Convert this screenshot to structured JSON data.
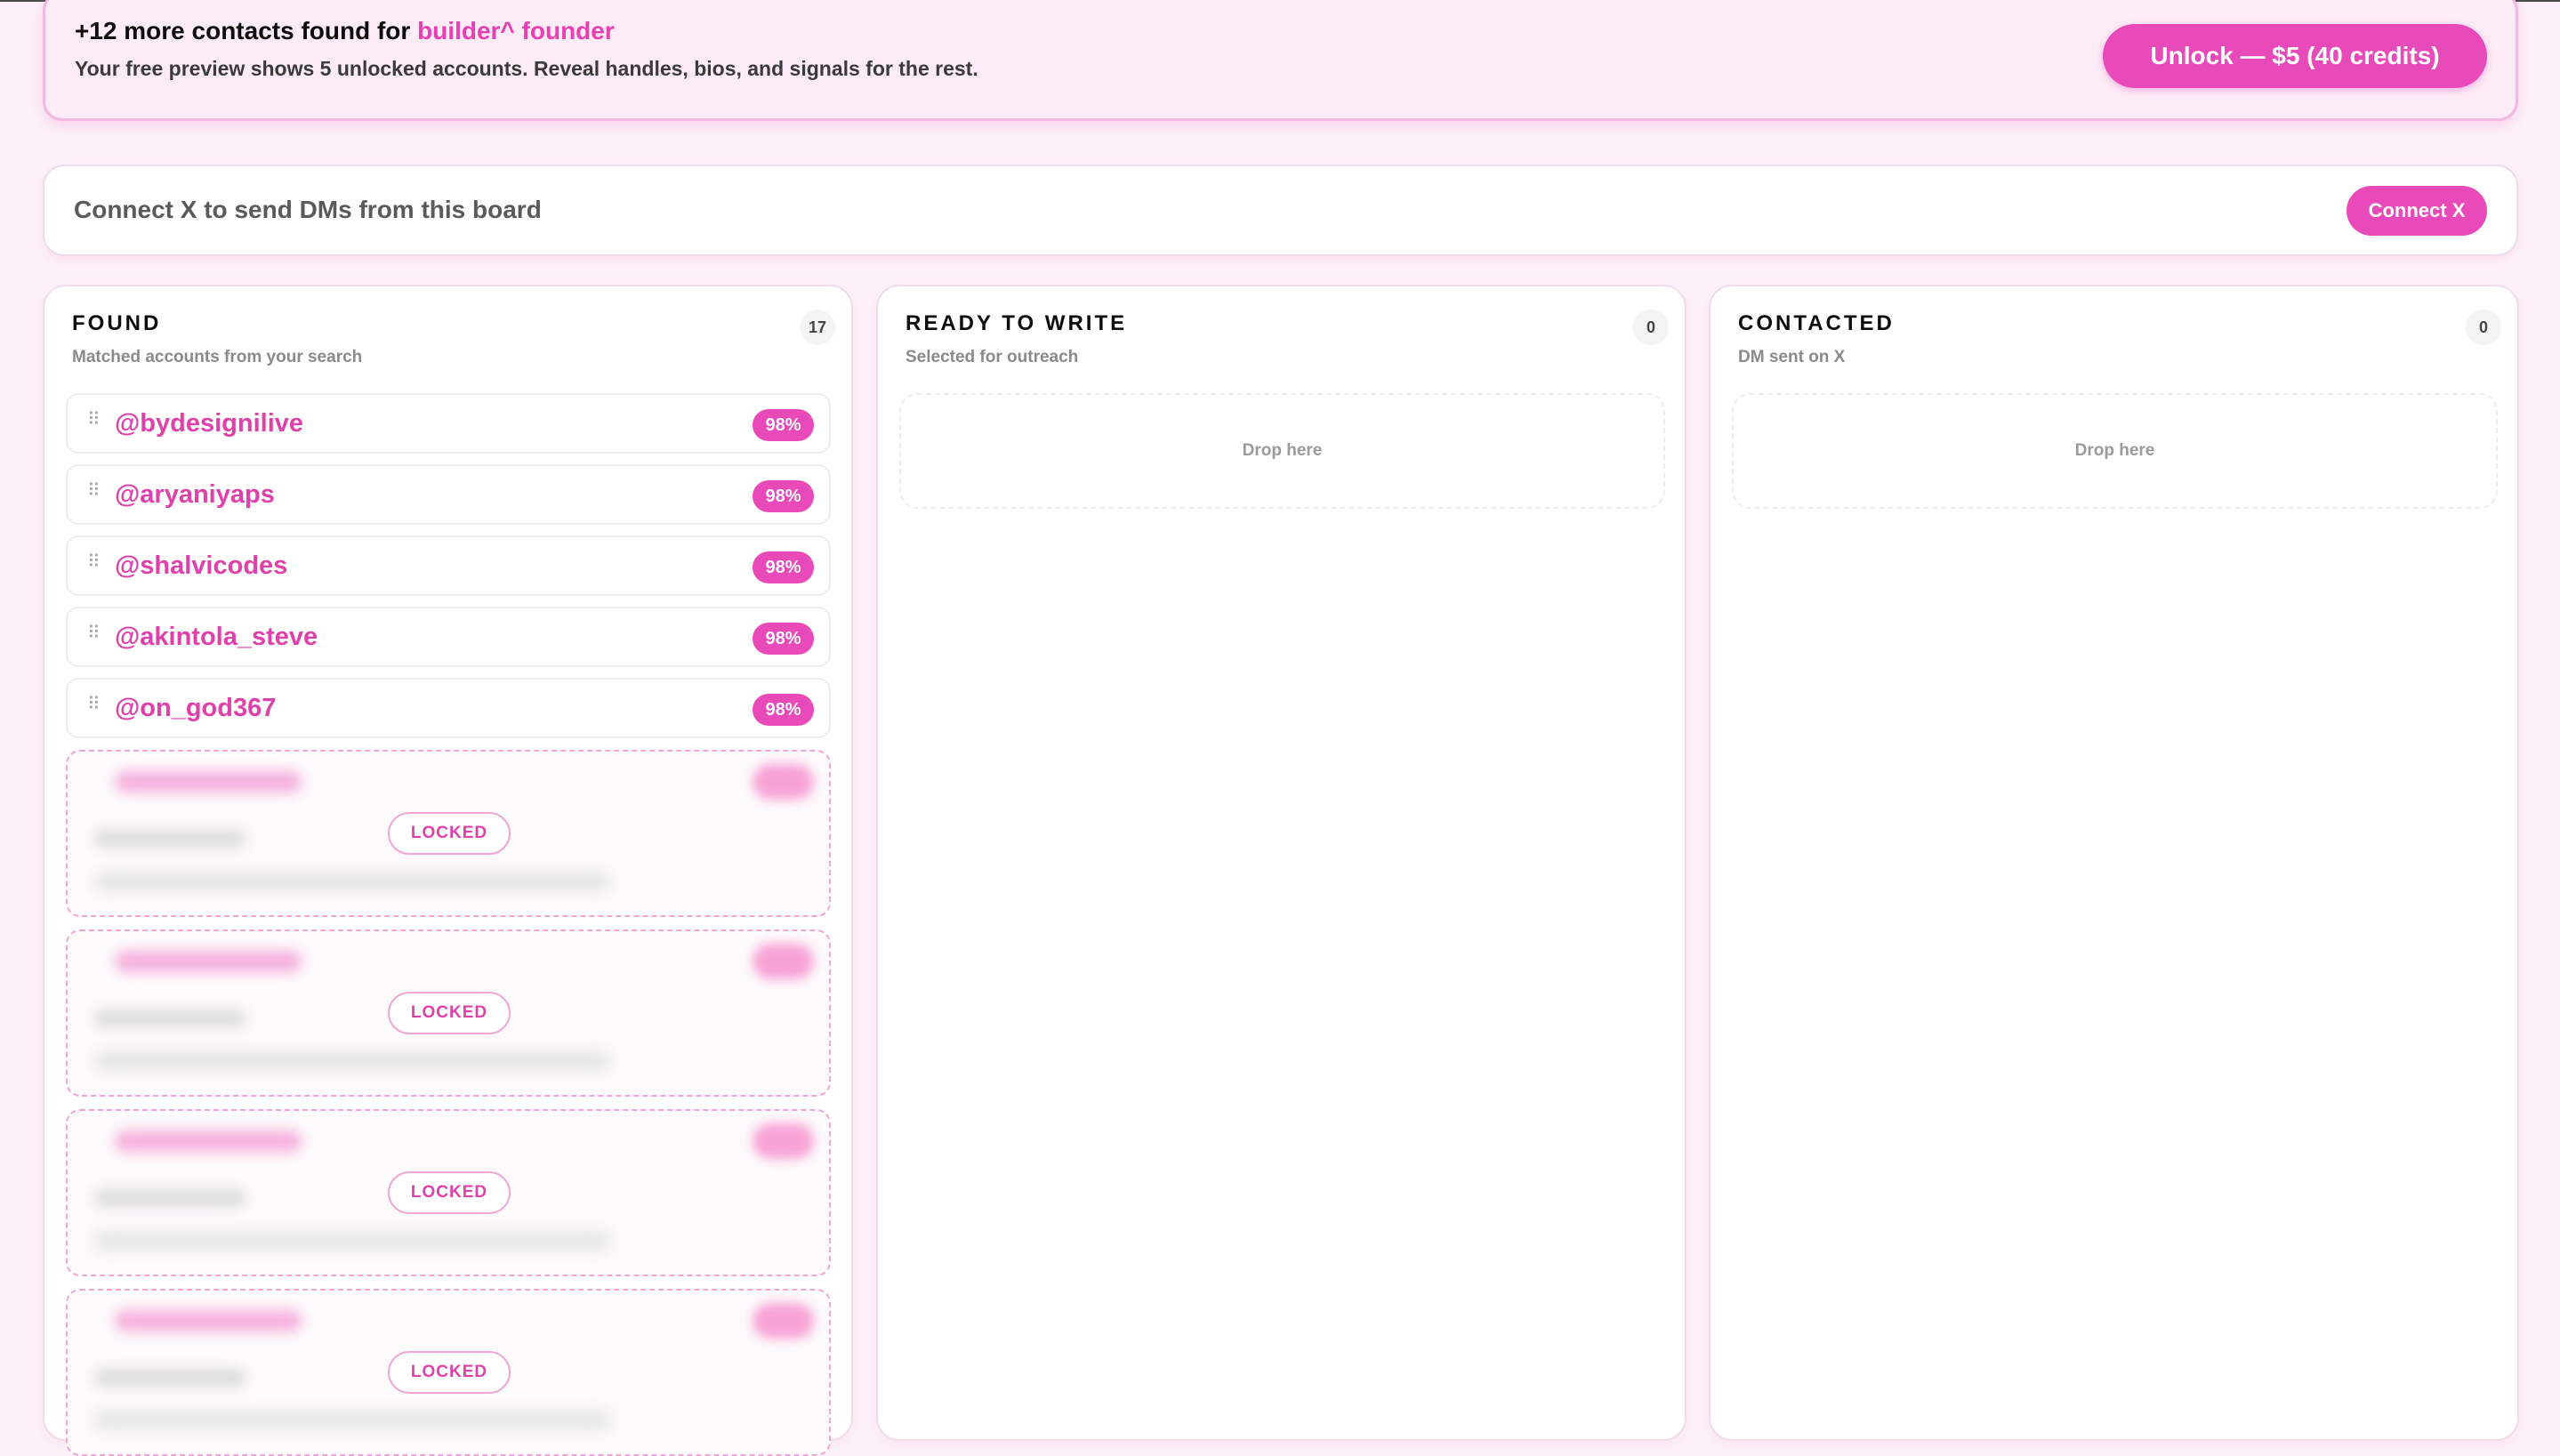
{
  "banner": {
    "title_prefix": "+12 more contacts found for ",
    "query": "builder^ founder",
    "subtitle": "Your free preview shows 5 unlocked accounts. Reveal handles, bios, and signals for the rest.",
    "unlock_label": "Unlock — $5 (40 credits)"
  },
  "connect": {
    "text": "Connect X to send DMs from this board",
    "button_label": "Connect X"
  },
  "columns": [
    {
      "title": "FOUND",
      "subtitle": "Matched accounts from your search",
      "count": "17"
    },
    {
      "title": "READY TO WRITE",
      "subtitle": "Selected for outreach",
      "count": "0",
      "drop_label": "Drop here"
    },
    {
      "title": "CONTACTED",
      "subtitle": "DM sent on X",
      "count": "0",
      "drop_label": "Drop here"
    }
  ],
  "found_cards": [
    {
      "handle": "@bydesignilive",
      "score": "98%"
    },
    {
      "handle": "@aryaniyaps",
      "score": "98%"
    },
    {
      "handle": "@shalvicodes",
      "score": "98%"
    },
    {
      "handle": "@akintola_steve",
      "score": "98%"
    },
    {
      "handle": "@on_god367",
      "score": "98%"
    }
  ],
  "locked_label": "LOCKED",
  "colors": {
    "accent": "#e94aba",
    "handle": "#e040a9",
    "background": "#fcf1fa"
  },
  "icons": {
    "drag": "drag-handle-icon"
  }
}
